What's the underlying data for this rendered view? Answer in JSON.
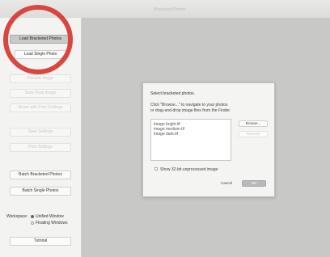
{
  "window": {
    "title": "Bracketed Photos"
  },
  "sidebar": {
    "load_bracketed_label": "Load Bracketed Photos",
    "load_single_label": "Load Single Photo",
    "disabled_1_label": "Preview Image",
    "disabled_2_label": "Save Final Image",
    "disabled_3_label": "Reset with Prior Settings",
    "disabled_4_label": "Save Settings",
    "disabled_5_label": "Prior Settings",
    "batch_bracketed_label": "Batch Bracketed Photos",
    "batch_single_label": "Batch Single Photos",
    "workspace_label": "Workspace:",
    "workspace_options": [
      "Unified Window",
      "Floating Windows"
    ],
    "workspace_selected": "Unified Window",
    "tutorial_label": "Tutorial"
  },
  "dialog": {
    "heading": "Select bracketed photos.",
    "instructions_line1": "Click \"Browse...\" to navigate to your photos",
    "instructions_line2": "or drag-and-drop image files from the Finder.",
    "files": [
      "image bright.tif",
      "image medium.tif",
      "image dark.tif"
    ],
    "browse_label": "Browse...",
    "remove_label": "Remove",
    "show_uncorrected_label": "Show 32-bit unprocessed image",
    "cancel_label": "Cancel",
    "ok_label": "OK"
  },
  "colors": {
    "highlight_ring": "#d8473f"
  }
}
